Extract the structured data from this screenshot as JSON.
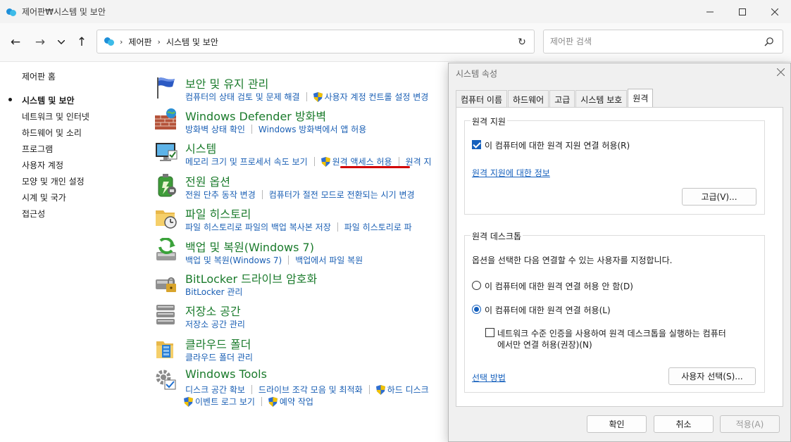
{
  "window": {
    "title": "제어판₩시스템 및 보안"
  },
  "nav": {
    "breadcrumbs": [
      "제어판",
      "시스템 및 보안"
    ],
    "search_placeholder": "제어판 검색"
  },
  "leftnav": {
    "items": [
      "제어판 홈",
      "시스템 및 보안",
      "네트워크 및 인터넷",
      "하드웨어 및 소리",
      "프로그램",
      "사용자 계정",
      "모양 및 개인 설정",
      "시계 및 국가",
      "접근성"
    ],
    "current": "시스템 및 보안"
  },
  "categories": [
    {
      "title": "보안 및 유지 관리",
      "icon": "flag-icon",
      "links": [
        "컴퓨터의 상태 검토 및 문제 해결",
        "사용자 계정 컨트롤 설정 변경"
      ]
    },
    {
      "title": "Windows Defender 방화벽",
      "icon": "firewall-icon",
      "links": [
        "방화벽 상태 확인",
        "Windows 방화벽에서 앱 허용"
      ]
    },
    {
      "title": "시스템",
      "icon": "monitor-icon",
      "links": [
        "메모리 크기 및 프로세서 속도 보기",
        "원격 액세스 허용",
        "원격 지"
      ]
    },
    {
      "title": "전원 옵션",
      "icon": "battery-icon",
      "links": [
        "전원 단추 동작 변경",
        "컴퓨터가 절전 모드로 전환되는 시기 변경"
      ]
    },
    {
      "title": "파일 히스토리",
      "icon": "folder-clock-icon",
      "links": [
        "파일 히스토리로 파일의 백업 복사본 저장",
        "파일 히스토리로 파"
      ]
    },
    {
      "title": "백업 및 복원(Windows 7)",
      "icon": "backup-icon",
      "links": [
        "백업 및 복원(Windows 7)",
        "백업에서 파일 복원"
      ]
    },
    {
      "title": "BitLocker 드라이브 암호화",
      "icon": "drive-lock-icon",
      "links": [
        "BitLocker 관리"
      ]
    },
    {
      "title": "저장소 공간",
      "icon": "storage-icon",
      "links": [
        "저장소 공간 관리"
      ]
    },
    {
      "title": "클라우드 폴더",
      "icon": "cloud-folder-icon",
      "links": [
        "클라우드 폴더 관리"
      ]
    },
    {
      "title": "Windows Tools",
      "icon": "tools-icon",
      "links": [
        "디스크 공간 확보",
        "드라이브 조각 모음 및 최적화",
        "하드 디스크"
      ],
      "links2": [
        "이벤트 로그 보기",
        "예약 작업"
      ]
    }
  ],
  "dialog": {
    "title": "시스템 속성",
    "tabs": [
      "컴퓨터 이름",
      "하드웨어",
      "고급",
      "시스템 보호",
      "원격"
    ],
    "active_tab": "원격",
    "remote_assistance": {
      "group_title": "원격 지원",
      "allow_label": "이 컴퓨터에 대한 원격 지원 연결 허용(R)",
      "allow_checked": true,
      "info_link": "원격 지원에 대한 정보",
      "advanced_button": "고급(V)..."
    },
    "remote_desktop": {
      "group_title": "원격 데스크톱",
      "instruction": "옵션을 선택한 다음 연결할 수 있는 사용자를 지정합니다.",
      "option_deny": "이 컴퓨터에 대한 원격 연결 허용 안 함(D)",
      "option_allow": "이 컴퓨터에 대한 원격 연결 허용(L)",
      "selected": "allow",
      "nla_line1": "네트워크 수준 인증을 사용하여 원격 데스크톱을 실행하는 컴퓨터",
      "nla_line2": "에서만 연결 허용(권장)(N)",
      "nla_checked": false,
      "help_link": "선택 방법",
      "select_users_button": "사용자 선택(S)..."
    },
    "buttons": {
      "ok": "확인",
      "cancel": "취소",
      "apply": "적용(A)"
    }
  }
}
